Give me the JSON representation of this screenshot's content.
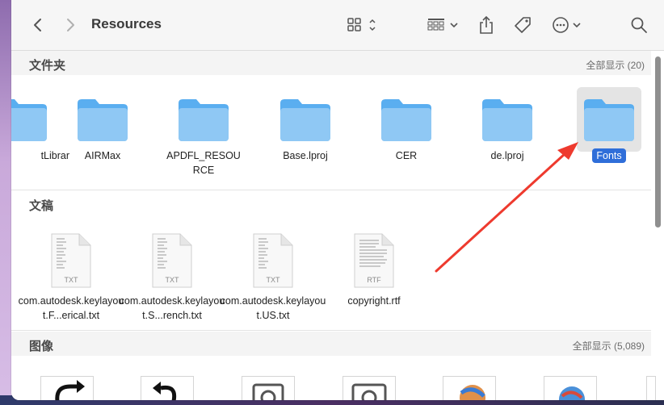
{
  "window": {
    "title": "Resources"
  },
  "toolbar": {
    "back_icon": "chevron-left-icon",
    "forward_icon": "chevron-right-icon",
    "view_icon": "grid-view-icon",
    "group_icon": "group-icon",
    "share_icon": "share-icon",
    "tag_icon": "tag-icon",
    "more_icon": "ellipsis-circle-icon",
    "search_icon": "search-icon"
  },
  "sections": {
    "folders": {
      "title": "文件夹",
      "action": "全部显示 (20)",
      "items": [
        {
          "label": "tLibrar"
        },
        {
          "label": "AIRMax"
        },
        {
          "label": "APDFL_RESOURCE"
        },
        {
          "label": "Base.lproj"
        },
        {
          "label": "CER"
        },
        {
          "label": "de.lproj"
        },
        {
          "label": "Fonts"
        }
      ]
    },
    "documents": {
      "title": "文稿",
      "items": [
        {
          "label": "com.autodesk.keylayout.F...erical.txt",
          "badge": "TXT"
        },
        {
          "label": "com.autodesk.keylayout.S...rench.txt",
          "badge": "TXT"
        },
        {
          "label": "com.autodesk.keylayout.US.txt",
          "badge": "TXT"
        },
        {
          "label": "copyright.rtf",
          "badge": "RTF"
        }
      ]
    },
    "images": {
      "title": "图像",
      "action": "全部显示 (5,089)"
    }
  },
  "colors": {
    "folder_light": "#8fc8f4",
    "folder_dark": "#5aaef0",
    "selection": "#2f6ed9",
    "annotation_arrow": "#ee3a2e"
  }
}
